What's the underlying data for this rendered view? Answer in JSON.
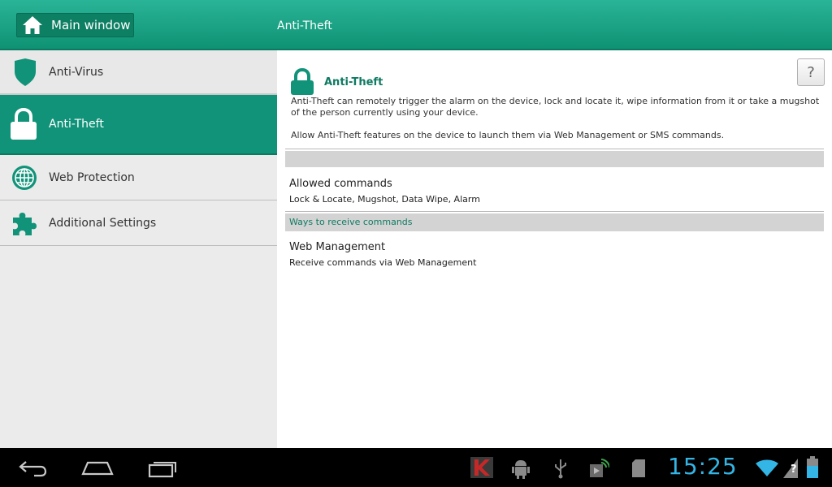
{
  "header": {
    "main_window_label": "Main window",
    "title": "Anti-Theft"
  },
  "sidebar": {
    "items": [
      {
        "label": "Anti-Virus",
        "icon": "shield-icon"
      },
      {
        "label": "Anti-Theft",
        "icon": "lock-icon",
        "selected": true
      },
      {
        "label": "Web Protection",
        "icon": "globe-icon"
      },
      {
        "label": "Additional Settings",
        "icon": "puzzle-icon"
      }
    ]
  },
  "content": {
    "help_label": "?",
    "title": "Anti-Theft",
    "description": "Anti-Theft can remotely trigger the alarm on the device, lock and locate it, wipe information from it or take a mugshot of the person currently using your device.",
    "allow_text": "Allow Anti-Theft features on the device to launch them via Web Management or SMS commands.",
    "allowed_commands": {
      "title": "Allowed commands",
      "value": "Lock & Locate, Mugshot, Data Wipe, Alarm"
    },
    "ways_header": "Ways to receive commands",
    "web_management": {
      "title": "Web Management",
      "value": "Receive commands via Web Management"
    }
  },
  "status": {
    "time": "15:25"
  },
  "colors": {
    "accent": "#119379",
    "accent_dark": "#0d7f63",
    "title_green": "#0f7a62",
    "clock_blue": "#33b5e5"
  }
}
